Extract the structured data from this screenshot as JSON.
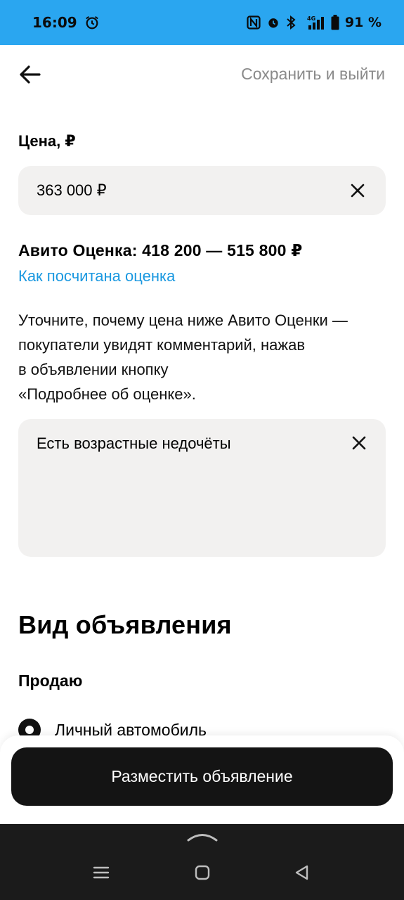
{
  "status_bar": {
    "time": "16:09",
    "battery": "91 %",
    "icons": [
      "alarm-icon",
      "nfc-icon",
      "alarm-icon",
      "bluetooth-icon",
      "signal-4g-icon",
      "battery-icon"
    ]
  },
  "header": {
    "back_icon": "arrow-left-icon",
    "save_exit_label": "Сохранить и выйти"
  },
  "price": {
    "label": "Цена, ₽",
    "value": "363 000 ₽",
    "clear_icon": "close-icon"
  },
  "estimate": {
    "text": "Авито Оценка: 418 200 — 515 800 ₽",
    "link": "Как посчитана оценка"
  },
  "hint": {
    "line1": "Уточните, почему цена ниже Авито Оценки —",
    "line2": "покупатели увидят комментарий, нажав",
    "line3": "в объявлении кнопку",
    "line4": "«Подробнее об оценке»."
  },
  "comment": {
    "value": "Есть возрастные недочёты",
    "clear_icon": "close-icon"
  },
  "listing_type": {
    "title": "Вид объявления",
    "sell_label": "Продаю",
    "selected_option": "Личный автомобиль"
  },
  "actions": {
    "publish_label": "Разместить объявление"
  },
  "system_nav": {
    "icons": [
      "chevron-up-icon",
      "menu-icon",
      "home-icon",
      "back-triangle-icon"
    ]
  },
  "colors": {
    "status_bar": "#2aa6f0",
    "link": "#1a98e0",
    "field_bg": "#f2f1f0",
    "button_bg": "#141414",
    "nav_bg": "#1b1b1b"
  }
}
